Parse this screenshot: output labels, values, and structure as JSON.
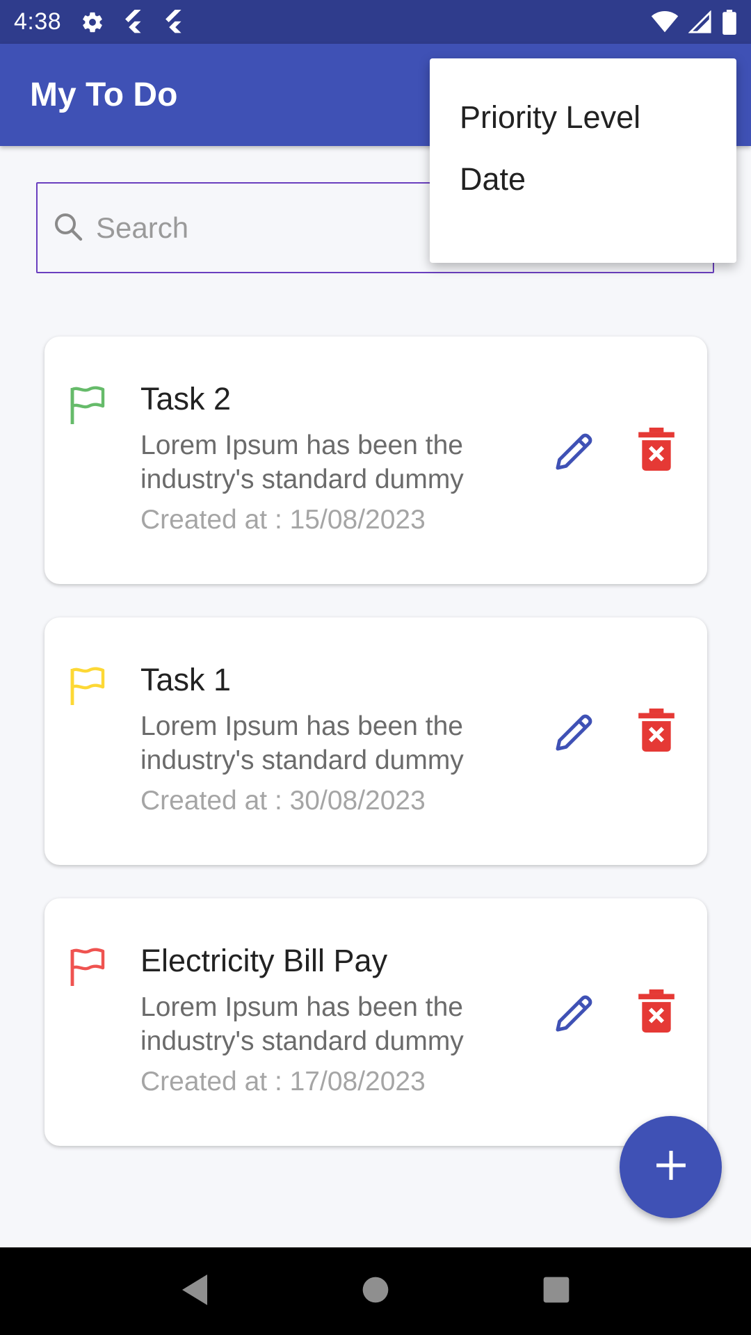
{
  "status_bar": {
    "time": "4:38",
    "left_icons": [
      "gear-icon",
      "flutter-icon",
      "flutter-icon"
    ],
    "right_icons": [
      "wifi-icon",
      "signal-icon",
      "battery-icon"
    ]
  },
  "app_bar": {
    "title": "My To Do"
  },
  "search": {
    "placeholder": "Search",
    "value": ""
  },
  "sort_menu": {
    "items": [
      {
        "label": "Priority Level"
      },
      {
        "label": "Date"
      }
    ]
  },
  "tasks": [
    {
      "title": "Task 2",
      "description": "Lorem Ipsum has been the industry's standard dummy",
      "created": "Created at : 15/08/2023",
      "flag_color": "#66bb6a"
    },
    {
      "title": "Task 1",
      "description": "Lorem Ipsum has been the industry's standard dummy",
      "created": "Created at : 30/08/2023",
      "flag_color": "#fdd835"
    },
    {
      "title": "Electricity Bill Pay",
      "description": "Lorem Ipsum has been the industry's standard dummy",
      "created": "Created at : 17/08/2023",
      "flag_color": "#ef5350"
    }
  ],
  "colors": {
    "primary": "#3f51b5",
    "status_bar": "#2f3c8c",
    "edit_icon": "#3f51b5",
    "delete_icon": "#e53935"
  },
  "fab": {
    "icon": "plus-icon"
  },
  "nav_bar": {
    "buttons": [
      "back-icon",
      "home-icon",
      "recents-icon"
    ]
  }
}
